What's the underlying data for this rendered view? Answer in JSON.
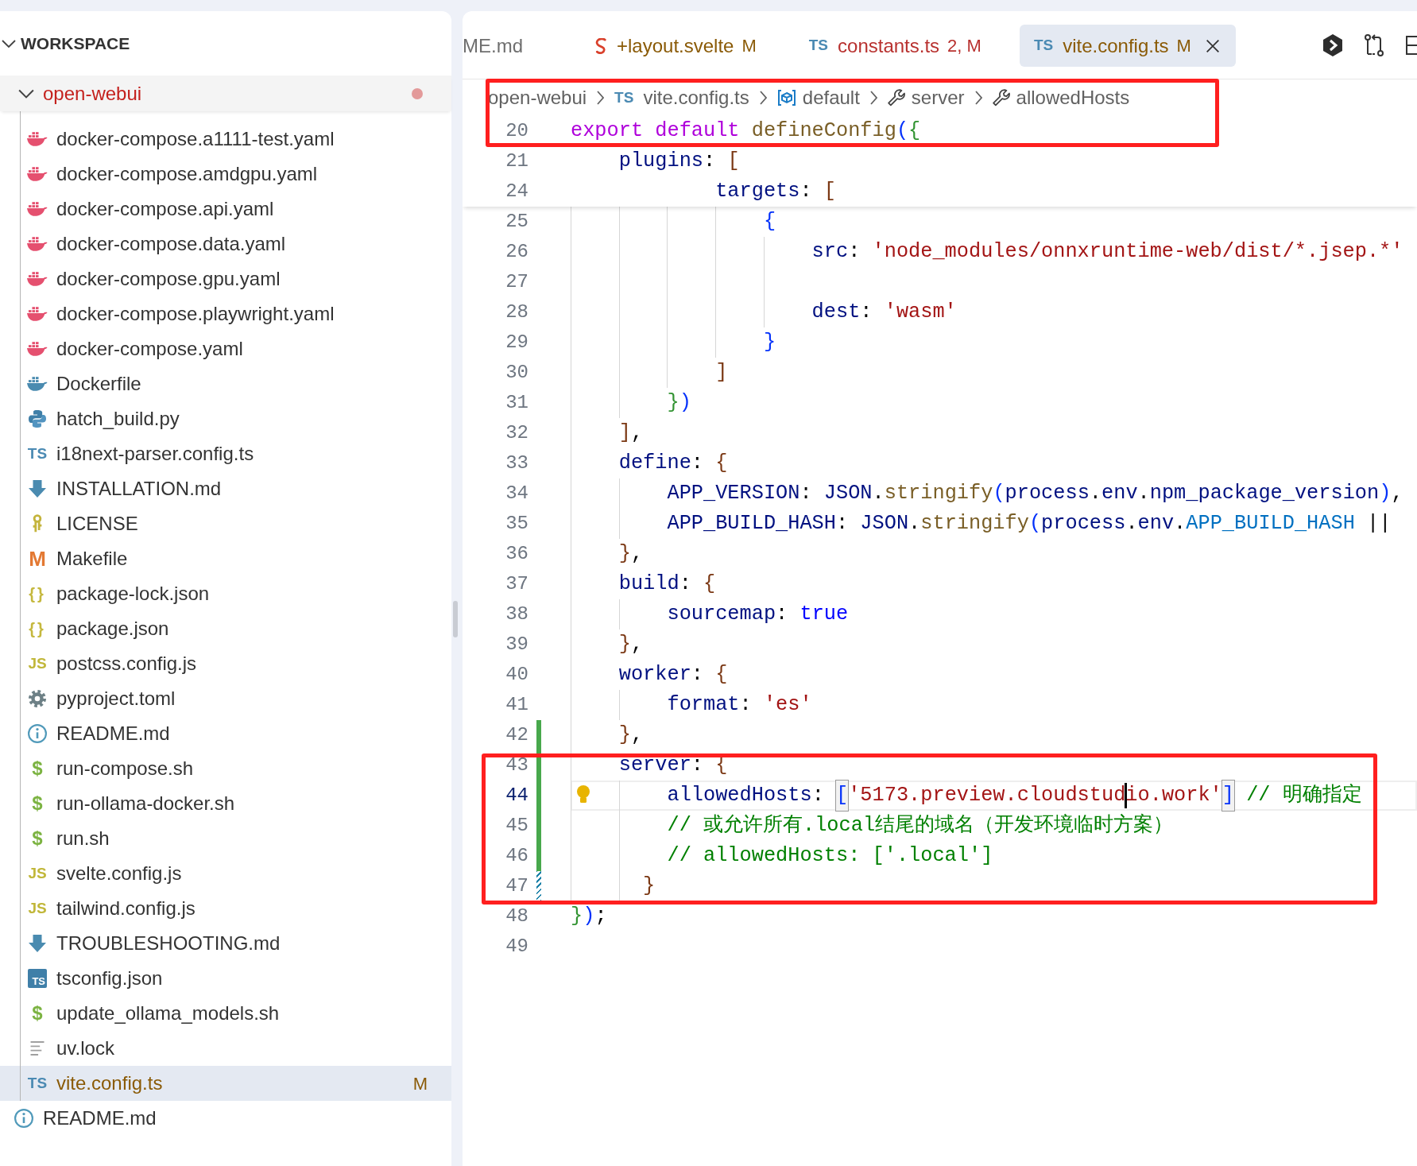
{
  "sidebar": {
    "title": "WORKSPACE",
    "expanded": true,
    "tree": [
      {
        "name": "open-webui",
        "kind": "folder",
        "expanded": true,
        "problems": true,
        "children": [
          {
            "name": "docker-compose.a1111-test.yaml",
            "kind": "compose",
            "selected": false
          },
          {
            "name": "docker-compose.amdgpu.yaml",
            "kind": "compose",
            "selected": false
          },
          {
            "name": "docker-compose.api.yaml",
            "kind": "compose",
            "selected": false
          },
          {
            "name": "docker-compose.data.yaml",
            "kind": "compose",
            "selected": false
          },
          {
            "name": "docker-compose.gpu.yaml",
            "kind": "compose",
            "selected": false
          },
          {
            "name": "docker-compose.playwright.yaml",
            "kind": "compose",
            "selected": false
          },
          {
            "name": "docker-compose.yaml",
            "kind": "compose",
            "selected": false
          },
          {
            "name": "Dockerfile",
            "kind": "dockerfile",
            "selected": false
          },
          {
            "name": "hatch_build.py",
            "kind": "python",
            "selected": false
          },
          {
            "name": "i18next-parser.config.ts",
            "kind": "ts",
            "icon_text": "TS",
            "selected": false
          },
          {
            "name": "INSTALLATION.md",
            "kind": "arrow",
            "selected": false
          },
          {
            "name": "LICENSE",
            "kind": "license",
            "selected": false
          },
          {
            "name": "Makefile",
            "kind": "makefile",
            "icon_text": "M",
            "selected": false
          },
          {
            "name": "package-lock.json",
            "kind": "json",
            "icon_text": "{}",
            "selected": false
          },
          {
            "name": "package.json",
            "kind": "json",
            "icon_text": "{}",
            "selected": false
          },
          {
            "name": "postcss.config.js",
            "kind": "js",
            "icon_text": "JS",
            "selected": false
          },
          {
            "name": "pyproject.toml",
            "kind": "gear",
            "selected": false
          },
          {
            "name": "README.md",
            "kind": "info",
            "selected": false
          },
          {
            "name": "run-compose.sh",
            "kind": "shell",
            "icon_text": "$",
            "selected": false
          },
          {
            "name": "run-ollama-docker.sh",
            "kind": "shell",
            "icon_text": "$",
            "selected": false
          },
          {
            "name": "run.sh",
            "kind": "shell",
            "icon_text": "$",
            "selected": false
          },
          {
            "name": "svelte.config.js",
            "kind": "js",
            "icon_text": "JS",
            "selected": false
          },
          {
            "name": "tailwind.config.js",
            "kind": "js",
            "icon_text": "JS",
            "selected": false
          },
          {
            "name": "TROUBLESHOOTING.md",
            "kind": "arrow",
            "selected": false
          },
          {
            "name": "tsconfig.json",
            "kind": "tsconfig",
            "icon_text": "TS",
            "selected": false
          },
          {
            "name": "update_ollama_models.sh",
            "kind": "shell",
            "icon_text": "$",
            "selected": false
          },
          {
            "name": "uv.lock",
            "kind": "text",
            "selected": false
          },
          {
            "name": "vite.config.ts",
            "kind": "ts",
            "icon_text": "TS",
            "status": "M",
            "selected": true
          }
        ]
      },
      {
        "name": "README.md",
        "kind": "info",
        "selected": false
      }
    ]
  },
  "tabs": [
    {
      "label": "ME.md",
      "kind": "markdown",
      "color": "#6f6f6f",
      "selected": false
    },
    {
      "label": "+layout.svelte",
      "kind": "svelte",
      "status": "M",
      "color": "#8a5a06",
      "selected": false
    },
    {
      "label": "constants.ts",
      "kind": "ts",
      "icon_text": "TS",
      "status": "2, M",
      "color": "#b8312f",
      "selected": false
    },
    {
      "label": "vite.config.ts",
      "kind": "ts",
      "icon_text": "TS",
      "status": "M",
      "color": "#8a5a06",
      "selected": true
    }
  ],
  "breadcrumb": [
    {
      "text": "open-webui",
      "kind": "folder"
    },
    {
      "text": "vite.config.ts",
      "kind": "ts",
      "icon_text": "TS"
    },
    {
      "text": "default",
      "kind": "module"
    },
    {
      "text": "server",
      "kind": "wrench"
    },
    {
      "text": "allowedHosts",
      "kind": "wrench"
    }
  ],
  "sticky_lines": [
    {
      "number": "20",
      "current": false,
      "tokens": [
        {
          "text": "export default",
          "kind": "keyword"
        },
        {
          "text": " defineConfig",
          "kind": "function"
        },
        {
          "text": "(",
          "kind": "bracket1"
        },
        {
          "text": "{",
          "kind": "bracket2"
        }
      ]
    },
    {
      "number": "21",
      "current": false,
      "tokens": [
        {
          "text": "    plugins",
          "kind": "property"
        },
        {
          "text": ": ",
          "kind": "punctuation"
        },
        {
          "text": "[",
          "kind": "bracket3"
        }
      ]
    },
    {
      "number": "24",
      "current": false,
      "tokens": [
        {
          "text": "            targets",
          "kind": "property"
        },
        {
          "text": ": ",
          "kind": "punctuation"
        },
        {
          "text": "[",
          "kind": "bracket3"
        }
      ]
    }
  ],
  "lines": [
    {
      "number": "25",
      "kind": "plain",
      "current": false,
      "tokens": [
        {
          "text": "                {",
          "kind": "bracket1"
        }
      ]
    },
    {
      "number": "26",
      "kind": "plain",
      "current": false,
      "tokens": [
        {
          "text": "                    src",
          "kind": "property"
        },
        {
          "text": ": ",
          "kind": "punctuation"
        },
        {
          "text": "'node_modules/onnxruntime-web/dist/*.jsep.*'",
          "kind": "string"
        }
      ]
    },
    {
      "number": "27",
      "kind": "plain",
      "current": false
    },
    {
      "number": "28",
      "kind": "plain",
      "current": false,
      "tokens": [
        {
          "text": "                    dest",
          "kind": "property"
        },
        {
          "text": ": ",
          "kind": "punctuation"
        },
        {
          "text": "'wasm'",
          "kind": "string"
        }
      ]
    },
    {
      "number": "29",
      "kind": "plain",
      "current": false,
      "tokens": [
        {
          "text": "                }",
          "kind": "bracket1"
        }
      ]
    },
    {
      "number": "30",
      "kind": "plain",
      "current": false,
      "tokens": [
        {
          "text": "            ]",
          "kind": "bracket3"
        }
      ]
    },
    {
      "number": "31",
      "kind": "plain",
      "current": false,
      "tokens": [
        {
          "text": "        }",
          "kind": "bracket2"
        },
        {
          "text": ")",
          "kind": "bracket1"
        }
      ]
    },
    {
      "number": "32",
      "kind": "plain",
      "current": false,
      "tokens": [
        {
          "text": "    ]",
          "kind": "bracket3"
        },
        {
          "text": ",",
          "kind": "punctuation"
        }
      ]
    },
    {
      "number": "33",
      "kind": "plain",
      "current": false,
      "tokens": [
        {
          "text": "    define",
          "kind": "property"
        },
        {
          "text": ": ",
          "kind": "punctuation"
        },
        {
          "text": "{",
          "kind": "bracket3"
        }
      ]
    },
    {
      "number": "34",
      "kind": "plain",
      "current": false,
      "tokens": [
        {
          "text": "        APP_VERSION",
          "kind": "property"
        },
        {
          "text": ": ",
          "kind": "punctuation"
        },
        {
          "text": "JSON",
          "kind": "property"
        },
        {
          "text": ".",
          "kind": "punctuation"
        },
        {
          "text": "stringify",
          "kind": "function"
        },
        {
          "text": "(",
          "kind": "bracket1"
        },
        {
          "text": "process",
          "kind": "property"
        },
        {
          "text": ".",
          "kind": "punctuation"
        },
        {
          "text": "env",
          "kind": "property"
        },
        {
          "text": ".",
          "kind": "punctuation"
        },
        {
          "text": "npm_package_version",
          "kind": "property"
        },
        {
          "text": ")",
          "kind": "bracket1"
        },
        {
          "text": ",",
          "kind": "punctuation"
        }
      ]
    },
    {
      "number": "35",
      "kind": "plain",
      "current": false,
      "tokens": [
        {
          "text": "        APP_BUILD_HASH",
          "kind": "property"
        },
        {
          "text": ": ",
          "kind": "punctuation"
        },
        {
          "text": "JSON",
          "kind": "property"
        },
        {
          "text": ".",
          "kind": "punctuation"
        },
        {
          "text": "stringify",
          "kind": "function"
        },
        {
          "text": "(",
          "kind": "bracket1"
        },
        {
          "text": "process",
          "kind": "property"
        },
        {
          "text": ".",
          "kind": "punctuation"
        },
        {
          "text": "env",
          "kind": "property"
        },
        {
          "text": ".",
          "kind": "punctuation"
        },
        {
          "text": "APP_BUILD_HASH",
          "kind": "constant"
        },
        {
          "text": " ||",
          "kind": "punctuation"
        }
      ]
    },
    {
      "number": "36",
      "kind": "plain",
      "current": false,
      "tokens": [
        {
          "text": "    }",
          "kind": "bracket3"
        },
        {
          "text": ",",
          "kind": "punctuation"
        }
      ]
    },
    {
      "number": "37",
      "kind": "plain",
      "current": false,
      "tokens": [
        {
          "text": "    build",
          "kind": "property"
        },
        {
          "text": ": ",
          "kind": "punctuation"
        },
        {
          "text": "{",
          "kind": "bracket3"
        }
      ]
    },
    {
      "number": "38",
      "kind": "plain",
      "current": false,
      "tokens": [
        {
          "text": "        sourcemap",
          "kind": "property"
        },
        {
          "text": ": ",
          "kind": "punctuation"
        },
        {
          "text": "true",
          "kind": "boolean"
        }
      ]
    },
    {
      "number": "39",
      "kind": "plain",
      "current": false,
      "tokens": [
        {
          "text": "    }",
          "kind": "bracket3"
        },
        {
          "text": ",",
          "kind": "punctuation"
        }
      ]
    },
    {
      "number": "40",
      "kind": "plain",
      "current": false,
      "tokens": [
        {
          "text": "    worker",
          "kind": "property"
        },
        {
          "text": ": ",
          "kind": "punctuation"
        },
        {
          "text": "{",
          "kind": "bracket3"
        }
      ]
    },
    {
      "number": "41",
      "kind": "plain",
      "current": false,
      "tokens": [
        {
          "text": "        format",
          "kind": "property"
        },
        {
          "text": ": ",
          "kind": "punctuation"
        },
        {
          "text": "'es'",
          "kind": "string"
        }
      ]
    },
    {
      "number": "42",
      "kind": "added",
      "current": false,
      "tokens": [
        {
          "text": "    }",
          "kind": "bracket3"
        },
        {
          "text": ",",
          "kind": "punctuation"
        }
      ]
    },
    {
      "number": "43",
      "kind": "added",
      "current": false,
      "tokens": [
        {
          "text": "    server",
          "kind": "property"
        },
        {
          "text": ": ",
          "kind": "punctuation"
        },
        {
          "text": "{",
          "kind": "bracket3"
        }
      ]
    },
    {
      "number": "44",
      "kind": "added",
      "current": true,
      "tokens": [
        {
          "text": "        allowedHosts",
          "kind": "property"
        },
        {
          "text": ": ",
          "kind": "punctuation"
        },
        {
          "text": "[",
          "kind": "bracket1",
          "matched": true
        },
        {
          "text": "'5173.preview.cloudstud",
          "kind": "string",
          "caret": true
        },
        {
          "text": "io.work'",
          "kind": "string"
        },
        {
          "text": "]",
          "kind": "bracket1",
          "matched": true
        },
        {
          "text": " // 明确指定",
          "kind": "comment"
        }
      ]
    },
    {
      "number": "45",
      "kind": "added",
      "current": false,
      "tokens": [
        {
          "text": "        // 或允许所有.local结尾的域名（开发环境临时方案）",
          "kind": "comment"
        }
      ]
    },
    {
      "number": "46",
      "kind": "added",
      "current": false,
      "tokens": [
        {
          "text": "        // allowedHosts: ['.local']",
          "kind": "comment"
        }
      ]
    },
    {
      "number": "47",
      "kind": "modified",
      "current": false,
      "tokens": [
        {
          "text": "      }",
          "kind": "bracket3"
        }
      ]
    },
    {
      "number": "48",
      "kind": "plain",
      "current": false,
      "tokens": [
        {
          "text": "}",
          "kind": "bracket2"
        },
        {
          "text": ")",
          "kind": "bracket1"
        },
        {
          "text": ";",
          "kind": "punctuation"
        }
      ]
    },
    {
      "number": "49",
      "kind": "plain",
      "current": false
    }
  ],
  "annotations": [
    {
      "kind": "box"
    },
    {
      "kind": "box"
    }
  ]
}
